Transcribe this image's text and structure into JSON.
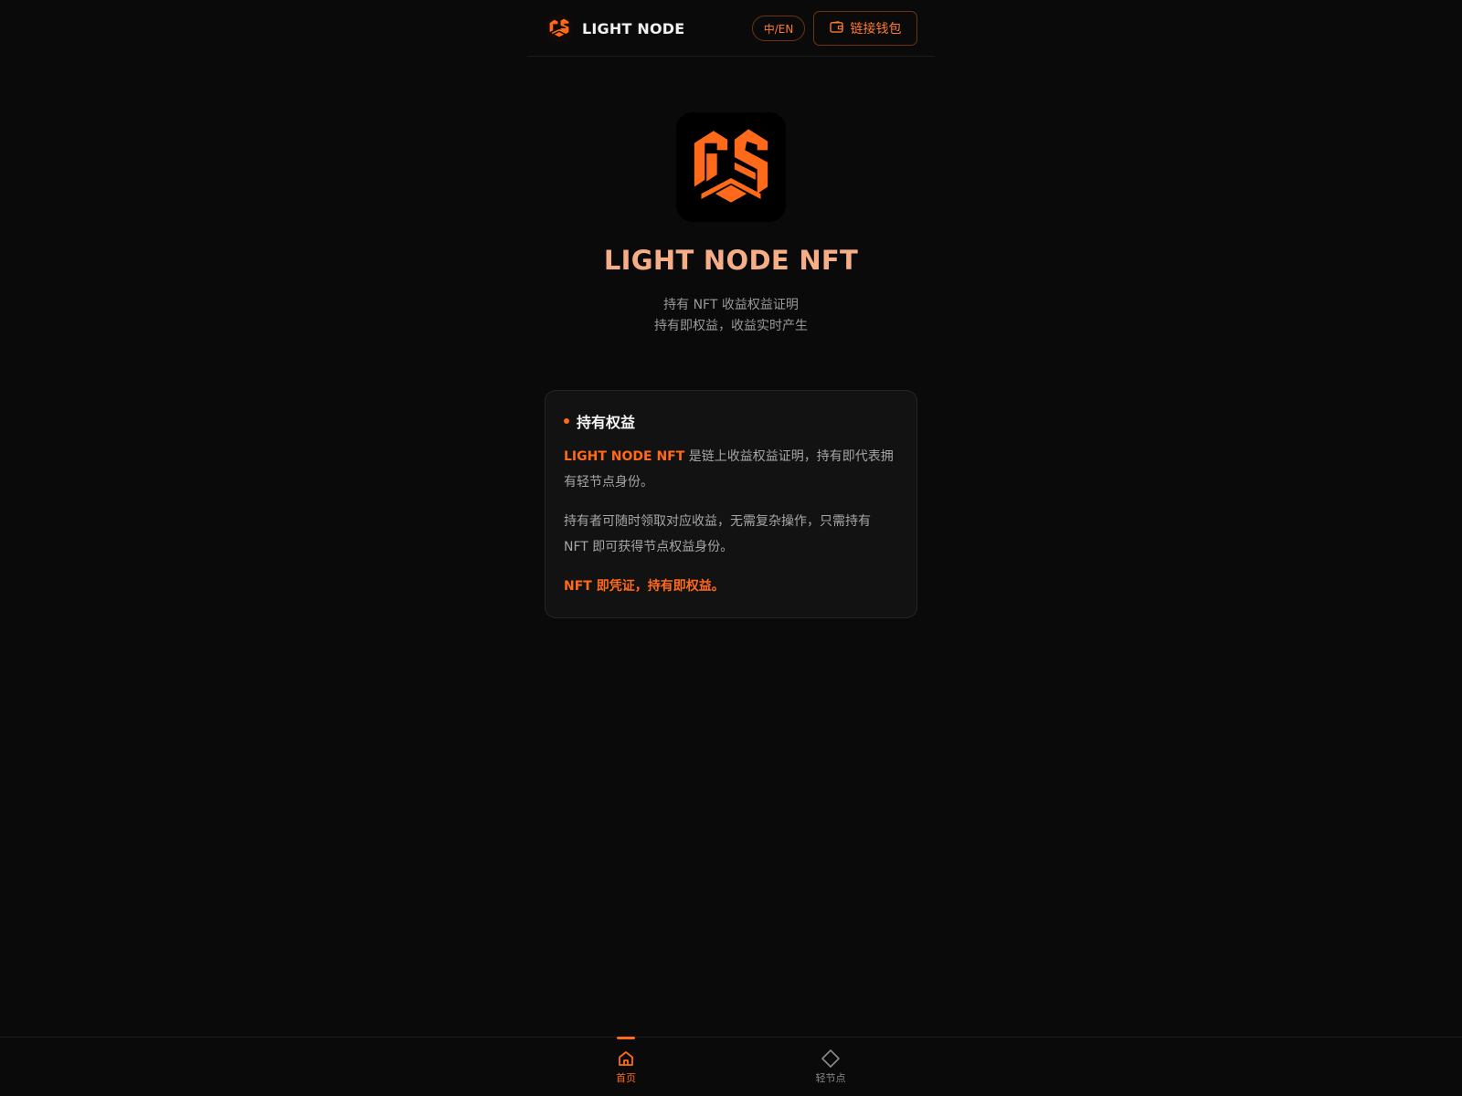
{
  "header": {
    "brand_name": "LIGHT NODE",
    "lang_toggle": "中/EN",
    "wallet_button": "链接钱包"
  },
  "hero": {
    "title": "LIGHT NODE NFT",
    "subtitle_line1": "持有 NFT 收益权益证明",
    "subtitle_line2": "持有即权益，收益实时产生"
  },
  "card": {
    "title": "持有权益",
    "p1_highlight": "LIGHT NODE NFT",
    "p1_text": " 是链上收益权益证明，持有即代表拥有轻节点身份。",
    "p2_text": "持有者可随时领取对应收益，无需复杂操作，只需持有 NFT 即可获得节点权益身份。",
    "p3_text": "NFT 即凭证，持有即权益。"
  },
  "bottom_nav": {
    "items": [
      {
        "label": "首页",
        "icon": "home-icon",
        "active": true
      },
      {
        "label": "轻节点",
        "icon": "diamond-icon",
        "active": false
      }
    ]
  },
  "colors": {
    "accent": "#ff6a1a",
    "title_gradient": "#f6ae86",
    "background": "#0a0a0a",
    "card_bg": "#121212"
  }
}
